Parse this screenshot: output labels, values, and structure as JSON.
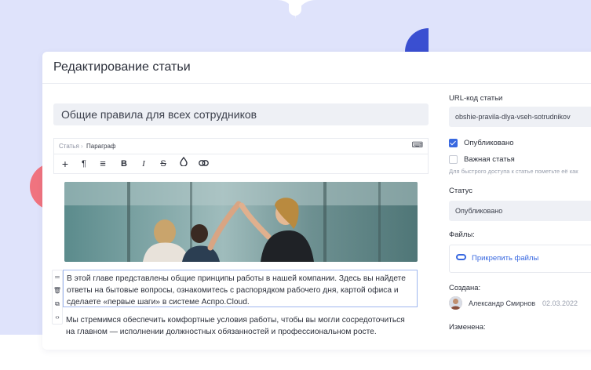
{
  "header": {
    "title": "Редактирование статьи"
  },
  "article": {
    "title": "Общие правила для всех сотрудников"
  },
  "editor": {
    "breadcrumb": [
      "Статья",
      "Параграф"
    ],
    "toolbar": [
      {
        "name": "add-icon",
        "glyph": "+"
      },
      {
        "name": "paragraph-icon",
        "glyph": "¶"
      },
      {
        "name": "align-icon",
        "glyph": "≡"
      },
      {
        "name": "bold-icon",
        "glyph": "B"
      },
      {
        "name": "italic-icon",
        "glyph": "I"
      },
      {
        "name": "strikethrough-icon",
        "glyph": "S"
      },
      {
        "name": "color-drop-icon",
        "glyph": "◊"
      },
      {
        "name": "link-icon",
        "glyph": "⊂⊃"
      }
    ],
    "side_tools": [
      "drag-handle-icon",
      "trash-icon",
      "copy-icon",
      "code-icon"
    ],
    "paragraphs": [
      "В этой главе представлены общие принципы работы в нашей компании. Здесь вы найдете ответы на бытовые вопросы, ознакомитесь с распорядком рабочего дня, картой офиса и сделаете «первые шаги» в системе Аспро.Cloud.",
      "Мы стремимся обеспечить комфортные условия работы, чтобы вы могли сосредоточиться на главном — исполнении должностных обязанностей и профессиональном росте."
    ]
  },
  "sidebar": {
    "url_label": "URL-код статьи",
    "url_value": "obshie-pravila-dlya-vseh-sotrudnikov",
    "published_label": "Опубликовано",
    "published_checked": true,
    "important_label": "Важная статья",
    "important_checked": false,
    "important_hint": "Для быстрого доступа к статье пометьте её как",
    "status_label": "Статус",
    "status_value": "Опубликовано",
    "files_label": "Файлы:",
    "attach_label": "Прикрепить файлы",
    "created_label": "Создана:",
    "author": "Александр Смирнов",
    "created_date": "02.03.2022",
    "modified_label": "Изменена:"
  },
  "colors": {
    "accent": "#3868e0",
    "background": "#dfe3fb",
    "coral": "#f0737f"
  }
}
